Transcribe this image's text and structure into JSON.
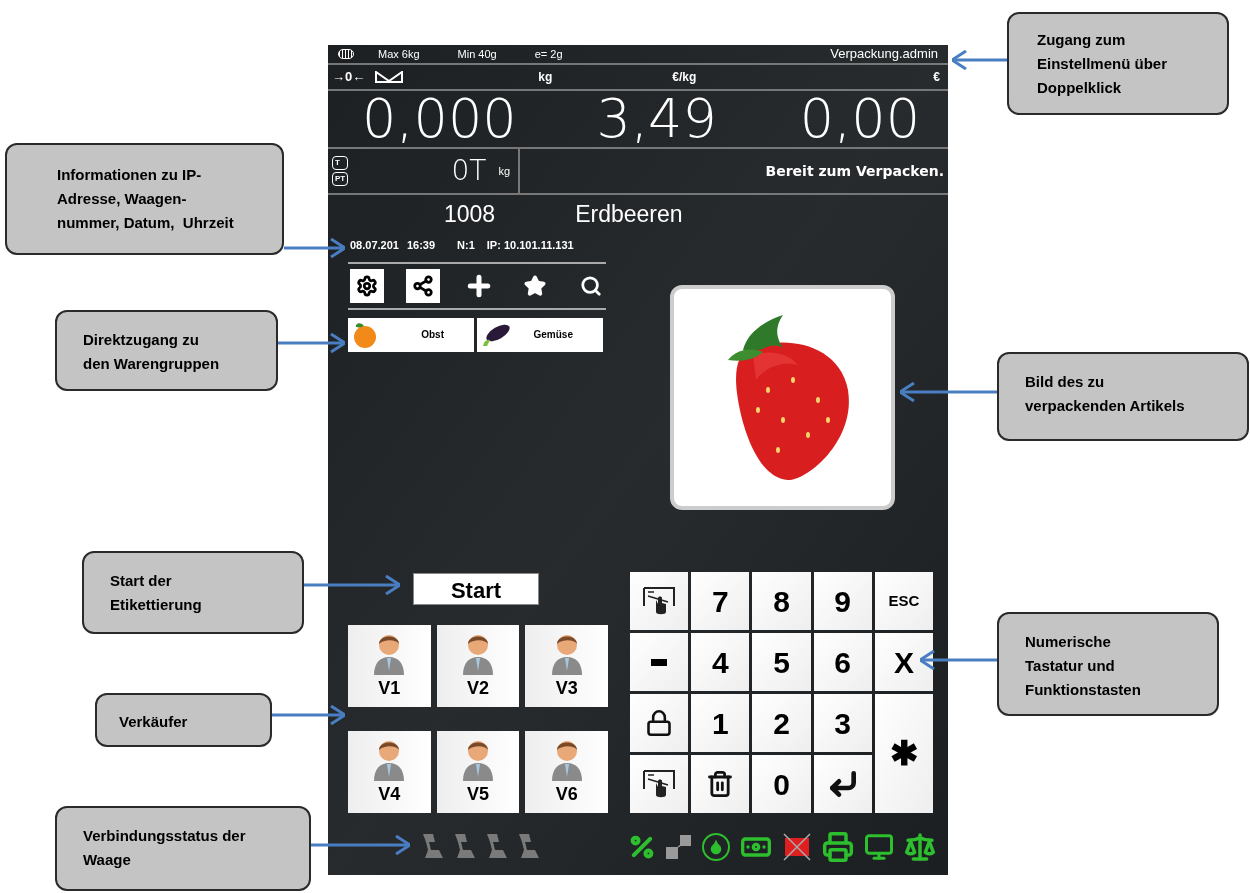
{
  "header": {
    "max": "Max 6kg",
    "min": "Min 40g",
    "division": "e= 2g",
    "user": "Verpackung.admin"
  },
  "zero_mark": "→0←",
  "units": [
    "kg",
    "€/kg",
    "€"
  ],
  "readings": [
    "0,000",
    "3,49",
    "0,00"
  ],
  "tare": {
    "marks": [
      "T",
      "PT"
    ],
    "value": "0T",
    "unit": "kg"
  },
  "status": "Bereit zum Verpacken.",
  "article": {
    "number": "1008",
    "name": "Erdbeeren"
  },
  "info": {
    "date": "08.07.201",
    "time": "16:39",
    "scale": "N:1",
    "ip": "IP: 10.101.11.131"
  },
  "toolbar": [
    {
      "kind": "settings",
      "selected": true
    },
    {
      "kind": "network",
      "selected": true
    },
    {
      "kind": "add",
      "selected": false
    },
    {
      "kind": "favorites",
      "selected": false
    },
    {
      "kind": "search",
      "selected": false
    }
  ],
  "categories": [
    {
      "label": "Obst",
      "kind": "orange"
    },
    {
      "label": "Gemüse",
      "kind": "eggplant"
    }
  ],
  "start": "Start",
  "vendors": [
    {
      "label": "V1"
    },
    {
      "label": "V2"
    },
    {
      "label": "V3"
    },
    {
      "label": "V4"
    },
    {
      "label": "V5"
    },
    {
      "label": "V6"
    }
  ],
  "keypad": [
    {
      "kind": "plu"
    },
    {
      "kind": "digit",
      "label": "7"
    },
    {
      "kind": "digit",
      "label": "8"
    },
    {
      "kind": "digit",
      "label": "9"
    },
    {
      "kind": "function",
      "label": "ESC"
    },
    {
      "kind": "minus"
    },
    {
      "kind": "digit",
      "label": "4"
    },
    {
      "kind": "digit",
      "label": "5"
    },
    {
      "kind": "digit",
      "label": "6"
    },
    {
      "kind": "digit",
      "label": "X"
    },
    {
      "kind": "lock"
    },
    {
      "kind": "digit",
      "label": "1"
    },
    {
      "kind": "digit",
      "label": "2"
    },
    {
      "kind": "digit",
      "label": "3"
    },
    {
      "kind": "tall",
      "label": "✱"
    },
    {
      "kind": "chg"
    },
    {
      "kind": "trash"
    },
    {
      "kind": "digit",
      "label": "0"
    },
    {
      "kind": "enter"
    }
  ],
  "connections": [
    {
      "connected": false
    },
    {
      "connected": false
    },
    {
      "connected": false
    },
    {
      "connected": false
    }
  ],
  "status_icons": [
    {
      "kind": "percent"
    },
    {
      "kind": "link"
    },
    {
      "kind": "drop"
    },
    {
      "kind": "money"
    },
    {
      "kind": "printer-off"
    },
    {
      "kind": "printer"
    },
    {
      "kind": "network"
    },
    {
      "kind": "scale"
    }
  ],
  "callouts": [
    {
      "lines": [
        "Zugang zum",
        "Einstellmenü über",
        "Doppelklick"
      ]
    },
    {
      "lines": [
        "Informationen zu IP-",
        "Adresse, Waagen-",
        "nummer, Datum,  Uhrzeit"
      ]
    },
    {
      "lines": [
        "Direktzugang zu",
        "den Warengruppen"
      ]
    },
    {
      "lines": [
        "Bild des zu",
        "verpackenden Artikels"
      ]
    },
    {
      "lines": [
        "Start der",
        "Etikettierung"
      ]
    },
    {
      "lines": [
        "Numerische",
        "Tastatur und",
        "Funktionstasten"
      ]
    },
    {
      "lines": [
        "Verkäufer"
      ]
    },
    {
      "lines": [
        "Verbindungsstatus der",
        "Waage"
      ]
    }
  ]
}
